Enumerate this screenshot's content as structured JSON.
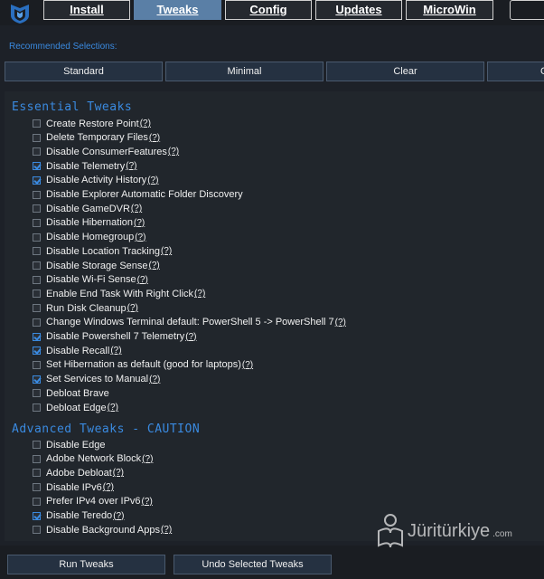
{
  "nav": {
    "tabs": [
      "Install",
      "Tweaks",
      "Config",
      "Updates",
      "MicroWin"
    ],
    "active": "Tweaks"
  },
  "recommended": {
    "label": "Recommended Selections:",
    "buttons": [
      "Standard",
      "Minimal",
      "Clear",
      "G"
    ]
  },
  "essential": {
    "title": "Essential Tweaks",
    "items": [
      {
        "label": "Create Restore Point",
        "checked": false,
        "help": "(?)"
      },
      {
        "label": "Delete Temporary Files",
        "checked": false,
        "help": "(?)"
      },
      {
        "label": "Disable ConsumerFeatures",
        "checked": false,
        "help": "(?)"
      },
      {
        "label": "Disable Telemetry",
        "checked": true,
        "help": "(?)"
      },
      {
        "label": "Disable Activity History",
        "checked": true,
        "help": "(?)"
      },
      {
        "label": "Disable Explorer Automatic Folder Discovery",
        "checked": false,
        "help": ""
      },
      {
        "label": "Disable GameDVR",
        "checked": false,
        "help": "(?)"
      },
      {
        "label": "Disable Hibernation",
        "checked": false,
        "help": "(?)"
      },
      {
        "label": "Disable Homegroup",
        "checked": false,
        "help": "(?)"
      },
      {
        "label": "Disable Location Tracking",
        "checked": false,
        "help": "(?)"
      },
      {
        "label": "Disable Storage Sense",
        "checked": false,
        "help": "(?)"
      },
      {
        "label": "Disable Wi-Fi Sense",
        "checked": false,
        "help": "(?)"
      },
      {
        "label": "Enable End Task With Right Click",
        "checked": false,
        "help": "(?)"
      },
      {
        "label": "Run Disk Cleanup",
        "checked": false,
        "help": "(?)"
      },
      {
        "label": "Change Windows Terminal default: PowerShell 5 -> PowerShell 7",
        "checked": false,
        "help": "(?)"
      },
      {
        "label": "Disable Powershell 7 Telemetry",
        "checked": true,
        "help": "(?)"
      },
      {
        "label": "Disable Recall",
        "checked": true,
        "help": "(?)"
      },
      {
        "label": "Set Hibernation as default (good for laptops)",
        "checked": false,
        "help": "(?)"
      },
      {
        "label": "Set Services to Manual",
        "checked": true,
        "help": "(?)"
      },
      {
        "label": "Debloat Brave",
        "checked": false,
        "help": ""
      },
      {
        "label": "Debloat Edge",
        "checked": false,
        "help": "(?)"
      }
    ]
  },
  "advanced": {
    "title": "Advanced Tweaks - CAUTION",
    "items": [
      {
        "label": "Disable Edge",
        "checked": false,
        "help": ""
      },
      {
        "label": "Adobe Network Block",
        "checked": false,
        "help": "(?)"
      },
      {
        "label": "Adobe Debloat",
        "checked": false,
        "help": "(?)"
      },
      {
        "label": "Disable IPv6",
        "checked": false,
        "help": "(?)"
      },
      {
        "label": "Prefer IPv4 over IPv6",
        "checked": false,
        "help": "(?)"
      },
      {
        "label": "Disable Teredo",
        "checked": true,
        "help": "(?)"
      },
      {
        "label": "Disable Background Apps",
        "checked": false,
        "help": "(?)"
      }
    ]
  },
  "actions": {
    "run": "Run Tweaks",
    "undo": "Undo Selected Tweaks"
  },
  "watermark": {
    "text": "Jüritürkiye",
    "suffix": ".com"
  },
  "colors": {
    "accent": "#3a8ae0",
    "active_tab": "#5a7fa6",
    "background": "#1d2128"
  }
}
